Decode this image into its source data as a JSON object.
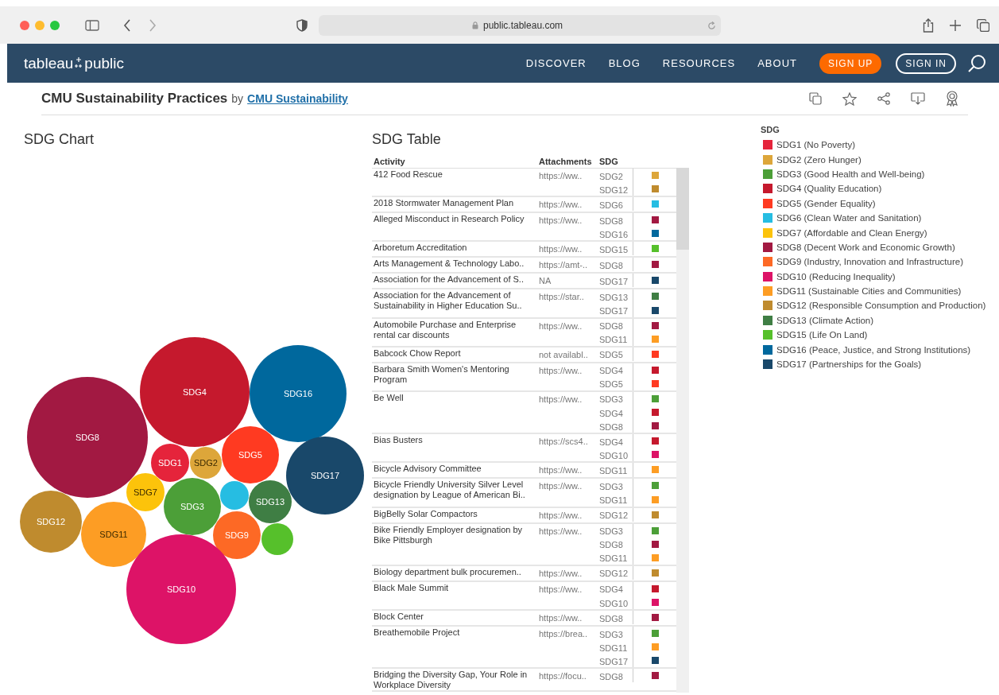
{
  "browser": {
    "url": "public.tableau.com"
  },
  "nav": {
    "logo": [
      "tableau",
      "public"
    ],
    "links": [
      "DISCOVER",
      "BLOG",
      "RESOURCES",
      "ABOUT"
    ],
    "sign_up": "SIGN UP",
    "sign_in": "SIGN IN"
  },
  "viz": {
    "title": "CMU Sustainability Practices",
    "by": "by",
    "author": "CMU Sustainability"
  },
  "sdg_chart": {
    "title": "SDG Chart",
    "bubbles": [
      {
        "label": "SDG8",
        "color": "#a21942"
      },
      {
        "label": "SDG4",
        "color": "#c5192d"
      },
      {
        "label": "SDG16",
        "color": "#00689d"
      },
      {
        "label": "SDG1",
        "color": "#e5243b"
      },
      {
        "label": "SDG2",
        "color": "#dda63a"
      },
      {
        "label": "SDG5",
        "color": "#ff3a21"
      },
      {
        "label": "SDG17",
        "color": "#19486a"
      },
      {
        "label": "SDG7",
        "color": "#fcc30b"
      },
      {
        "label": "SDG3",
        "color": "#4c9f38"
      },
      {
        "color": "#26bde2"
      },
      {
        "label": "SDG13",
        "color": "#3f7e44"
      },
      {
        "label": "SDG12",
        "color": "#bf8b2e"
      },
      {
        "label": "SDG11",
        "color": "#fd9d24"
      },
      {
        "label": "SDG9",
        "color": "#fd6925"
      },
      {
        "color": "#56c02b"
      },
      {
        "label": "SDG10",
        "color": "#dd1367"
      }
    ]
  },
  "sdg_table": {
    "title": "SDG Table",
    "columns": [
      "Activity",
      "Attachments",
      "SDG"
    ],
    "rows": [
      {
        "activity": "412 Food Rescue",
        "attachments": "https://ww..",
        "sdgs": [
          {
            "label": "SDG2",
            "color": "#dda63a"
          },
          {
            "label": "SDG12",
            "color": "#bf8b2e"
          }
        ]
      },
      {
        "activity": "2018 Stormwater Management Plan",
        "attachments": "https://ww..",
        "sdgs": [
          {
            "label": "SDG6",
            "color": "#26bde2"
          }
        ]
      },
      {
        "activity": "Alleged Misconduct in Research Policy",
        "attachments": "https://ww..",
        "sdgs": [
          {
            "label": "SDG8",
            "color": "#a21942"
          },
          {
            "label": "SDG16",
            "color": "#00689d"
          }
        ]
      },
      {
        "activity": "Arboretum Accreditation",
        "attachments": "https://ww..",
        "sdgs": [
          {
            "label": "SDG15",
            "color": "#56c02b"
          }
        ]
      },
      {
        "activity": "Arts Management & Technology Labo..",
        "attachments": "https://amt-..",
        "sdgs": [
          {
            "label": "SDG8",
            "color": "#a21942"
          }
        ]
      },
      {
        "activity": "Association for the Advancement of S..",
        "attachments": "NA",
        "sdgs": [
          {
            "label": "SDG17",
            "color": "#19486a"
          }
        ]
      },
      {
        "activity": "Association for the Advancement of Sustainability in Higher Education Su..",
        "attachments": "https://star..",
        "sdgs": [
          {
            "label": "SDG13",
            "color": "#3f7e44"
          },
          {
            "label": "SDG17",
            "color": "#19486a"
          }
        ]
      },
      {
        "activity": "Automobile Purchase and Enterprise rental car discounts",
        "attachments": "https://ww..",
        "sdgs": [
          {
            "label": "SDG8",
            "color": "#a21942"
          },
          {
            "label": "SDG11",
            "color": "#fd9d24"
          }
        ]
      },
      {
        "activity": "Babcock Chow Report",
        "attachments": "not availabl..",
        "sdgs": [
          {
            "label": "SDG5",
            "color": "#ff3a21"
          }
        ]
      },
      {
        "activity": "Barbara Smith Women's Mentoring Program",
        "attachments": "https://ww..",
        "sdgs": [
          {
            "label": "SDG4",
            "color": "#c5192d"
          },
          {
            "label": "SDG5",
            "color": "#ff3a21"
          }
        ]
      },
      {
        "activity": "Be Well",
        "attachments": "https://ww..",
        "sdgs": [
          {
            "label": "SDG3",
            "color": "#4c9f38"
          },
          {
            "label": "SDG4",
            "color": "#c5192d"
          },
          {
            "label": "SDG8",
            "color": "#a21942"
          }
        ]
      },
      {
        "activity": "Bias Busters",
        "attachments": "https://scs4..",
        "sdgs": [
          {
            "label": "SDG4",
            "color": "#c5192d"
          },
          {
            "label": "SDG10",
            "color": "#dd1367"
          }
        ]
      },
      {
        "activity": "Bicycle Advisory Committee",
        "attachments": "https://ww..",
        "sdgs": [
          {
            "label": "SDG11",
            "color": "#fd9d24"
          }
        ]
      },
      {
        "activity": "Bicycle Friendly University Silver Level designation by League of American Bi..",
        "attachments": "https://ww..",
        "sdgs": [
          {
            "label": "SDG3",
            "color": "#4c9f38"
          },
          {
            "label": "SDG11",
            "color": "#fd9d24"
          }
        ]
      },
      {
        "activity": "BigBelly Solar Compactors",
        "attachments": "https://ww..",
        "sdgs": [
          {
            "label": "SDG12",
            "color": "#bf8b2e"
          }
        ]
      },
      {
        "activity": "Bike Friendly Employer designation by Bike Pittsburgh",
        "attachments": "https://ww..",
        "sdgs": [
          {
            "label": "SDG3",
            "color": "#4c9f38"
          },
          {
            "label": "SDG8",
            "color": "#a21942"
          },
          {
            "label": "SDG11",
            "color": "#fd9d24"
          }
        ]
      },
      {
        "activity": "Biology department bulk procuremen..",
        "attachments": "https://ww..",
        "sdgs": [
          {
            "label": "SDG12",
            "color": "#bf8b2e"
          }
        ]
      },
      {
        "activity": "Black Male Summit",
        "attachments": "https://ww..",
        "sdgs": [
          {
            "label": "SDG4",
            "color": "#c5192d"
          },
          {
            "label": "SDG10",
            "color": "#dd1367"
          }
        ]
      },
      {
        "activity": "Block Center",
        "attachments": "https://ww..",
        "sdgs": [
          {
            "label": "SDG8",
            "color": "#a21942"
          }
        ]
      },
      {
        "activity": "Breathemobile Project",
        "attachments": "https://brea..",
        "sdgs": [
          {
            "label": "SDG3",
            "color": "#4c9f38"
          },
          {
            "label": "SDG11",
            "color": "#fd9d24"
          },
          {
            "label": "SDG17",
            "color": "#19486a"
          }
        ]
      },
      {
        "activity": "Bridging the Diversity Gap, Your Role in Workplace Diversity",
        "attachments": "https://focu..",
        "sdgs": [
          {
            "label": "SDG8",
            "color": "#a21942"
          }
        ]
      }
    ]
  },
  "legend": {
    "title": "SDG",
    "items": [
      {
        "label": "SDG1 (No Poverty)",
        "color": "#e5243b"
      },
      {
        "label": "SDG2 (Zero Hunger)",
        "color": "#dda63a"
      },
      {
        "label": "SDG3 (Good Health and Well-being)",
        "color": "#4c9f38"
      },
      {
        "label": "SDG4 (Quality Education)",
        "color": "#c5192d"
      },
      {
        "label": "SDG5 (Gender Equality)",
        "color": "#ff3a21"
      },
      {
        "label": "SDG6 (Clean Water and Sanitation)",
        "color": "#26bde2"
      },
      {
        "label": "SDG7 (Affordable and Clean Energy)",
        "color": "#fcc30b"
      },
      {
        "label": "SDG8 (Decent Work and Economic Growth)",
        "color": "#a21942"
      },
      {
        "label": "SDG9 (Industry, Innovation and Infrastructure)",
        "color": "#fd6925"
      },
      {
        "label": "SDG10 (Reducing Inequality)",
        "color": "#dd1367"
      },
      {
        "label": "SDG11 (Sustainable Cities and Communities)",
        "color": "#fd9d24"
      },
      {
        "label": "SDG12 (Responsible Consumption and Production)",
        "color": "#bf8b2e"
      },
      {
        "label": "SDG13 (Climate Action)",
        "color": "#3f7e44"
      },
      {
        "label": "SDG15 (Life On Land)",
        "color": "#56c02b"
      },
      {
        "label": "SDG16 (Peace, Justice, and Strong Institutions)",
        "color": "#00689d"
      },
      {
        "label": "SDG17 (Partnerships for the Goals)",
        "color": "#19486a"
      }
    ]
  }
}
